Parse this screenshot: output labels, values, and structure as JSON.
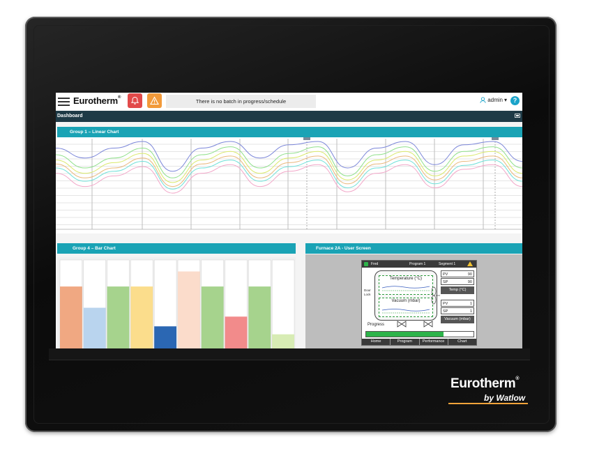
{
  "header": {
    "logo_text": "Eurotherm",
    "logo_mark": "®",
    "batch_status": "There is no batch in progress/schedule",
    "user_name": "admin",
    "user_caret": "▾",
    "help_label": "?",
    "icons": {
      "menu": "hamburger-icon",
      "alarm_red": "bell-icon",
      "alarm_orange": "warning-icon",
      "user": "user-icon",
      "help": "help-icon"
    }
  },
  "dashboard": {
    "title": "Dashboard"
  },
  "panels": {
    "linear": {
      "title": "Group 1 – Linear Chart"
    },
    "bar": {
      "title": "Group 4 – Bar Chart"
    },
    "user_screen": {
      "title": "Furnace 2A - User Screen"
    }
  },
  "chart_data": [
    {
      "type": "line",
      "series_colors": [
        "#7b86d9",
        "#8fe08a",
        "#d9e96b",
        "#e9b87b",
        "#6fe0d8",
        "#f2a6c8"
      ],
      "series": [
        {
          "values": [
            0.9,
            0.75,
            0.9,
            1.0,
            0.55,
            0.9,
            1.0,
            0.75,
            0.95,
            1.0,
            0.6,
            0.9,
            1.0,
            0.65,
            0.95,
            1.0,
            0.7
          ]
        },
        {
          "values": [
            0.8,
            0.6,
            0.75,
            0.9,
            0.45,
            0.8,
            0.92,
            0.6,
            0.82,
            0.92,
            0.48,
            0.8,
            0.92,
            0.55,
            0.85,
            0.92,
            0.6
          ]
        },
        {
          "values": [
            0.72,
            0.52,
            0.68,
            0.82,
            0.38,
            0.72,
            0.85,
            0.52,
            0.75,
            0.85,
            0.42,
            0.72,
            0.85,
            0.48,
            0.78,
            0.85,
            0.52
          ]
        },
        {
          "values": [
            0.66,
            0.45,
            0.6,
            0.75,
            0.32,
            0.66,
            0.78,
            0.45,
            0.68,
            0.78,
            0.36,
            0.66,
            0.78,
            0.42,
            0.7,
            0.78,
            0.45
          ]
        },
        {
          "values": [
            0.6,
            0.4,
            0.55,
            0.7,
            0.28,
            0.6,
            0.72,
            0.4,
            0.62,
            0.72,
            0.3,
            0.6,
            0.72,
            0.36,
            0.64,
            0.72,
            0.4
          ]
        },
        {
          "values": [
            0.52,
            0.32,
            0.48,
            0.62,
            0.22,
            0.52,
            0.65,
            0.32,
            0.55,
            0.65,
            0.24,
            0.52,
            0.65,
            0.3,
            0.58,
            0.65,
            0.32
          ]
        }
      ]
    },
    {
      "type": "bar",
      "ylim": [
        0,
        1
      ],
      "values": [
        0.7,
        0.46,
        0.7,
        0.7,
        0.25,
        0.87,
        0.7,
        0.36,
        0.7,
        0.16
      ],
      "colors": [
        "#f0a882",
        "#b9d4ee",
        "#a6d38d",
        "#fbdd8c",
        "#2b67b3",
        "#fbdccb",
        "#a6d38d",
        "#f28b8b",
        "#a6d38d",
        "#d7ecb4"
      ]
    }
  ],
  "hmi": {
    "user": "Fred",
    "program": "Program 1",
    "segment": "Segment 1",
    "temperature_label": "Temperature (°C)",
    "vacuum_label": "Vacuum (mbar)",
    "door_lock": "Door Lock",
    "progress_label": "Progress",
    "progress": 0.72,
    "temp_pv_label": "PV",
    "temp_pv": "90",
    "temp_sp_label": "SP",
    "temp_sp": "90",
    "temp_unit": "Temp (°C)",
    "vac_pv_label": "PV",
    "vac_pv": "1",
    "vac_sp_label": "SP",
    "vac_sp": "1",
    "vac_unit": "Vacuum (mbar)",
    "nav": [
      "Home",
      "Program",
      "Performance",
      "Chart"
    ]
  },
  "branding": {
    "main": "Eurotherm",
    "mark": "®",
    "sub": "by Watlow",
    "accent": "#f2a43a"
  },
  "colors": {
    "teal_header": "#1aa3b5",
    "dash_bar": "#1e3a46",
    "bezel": "#111111"
  }
}
